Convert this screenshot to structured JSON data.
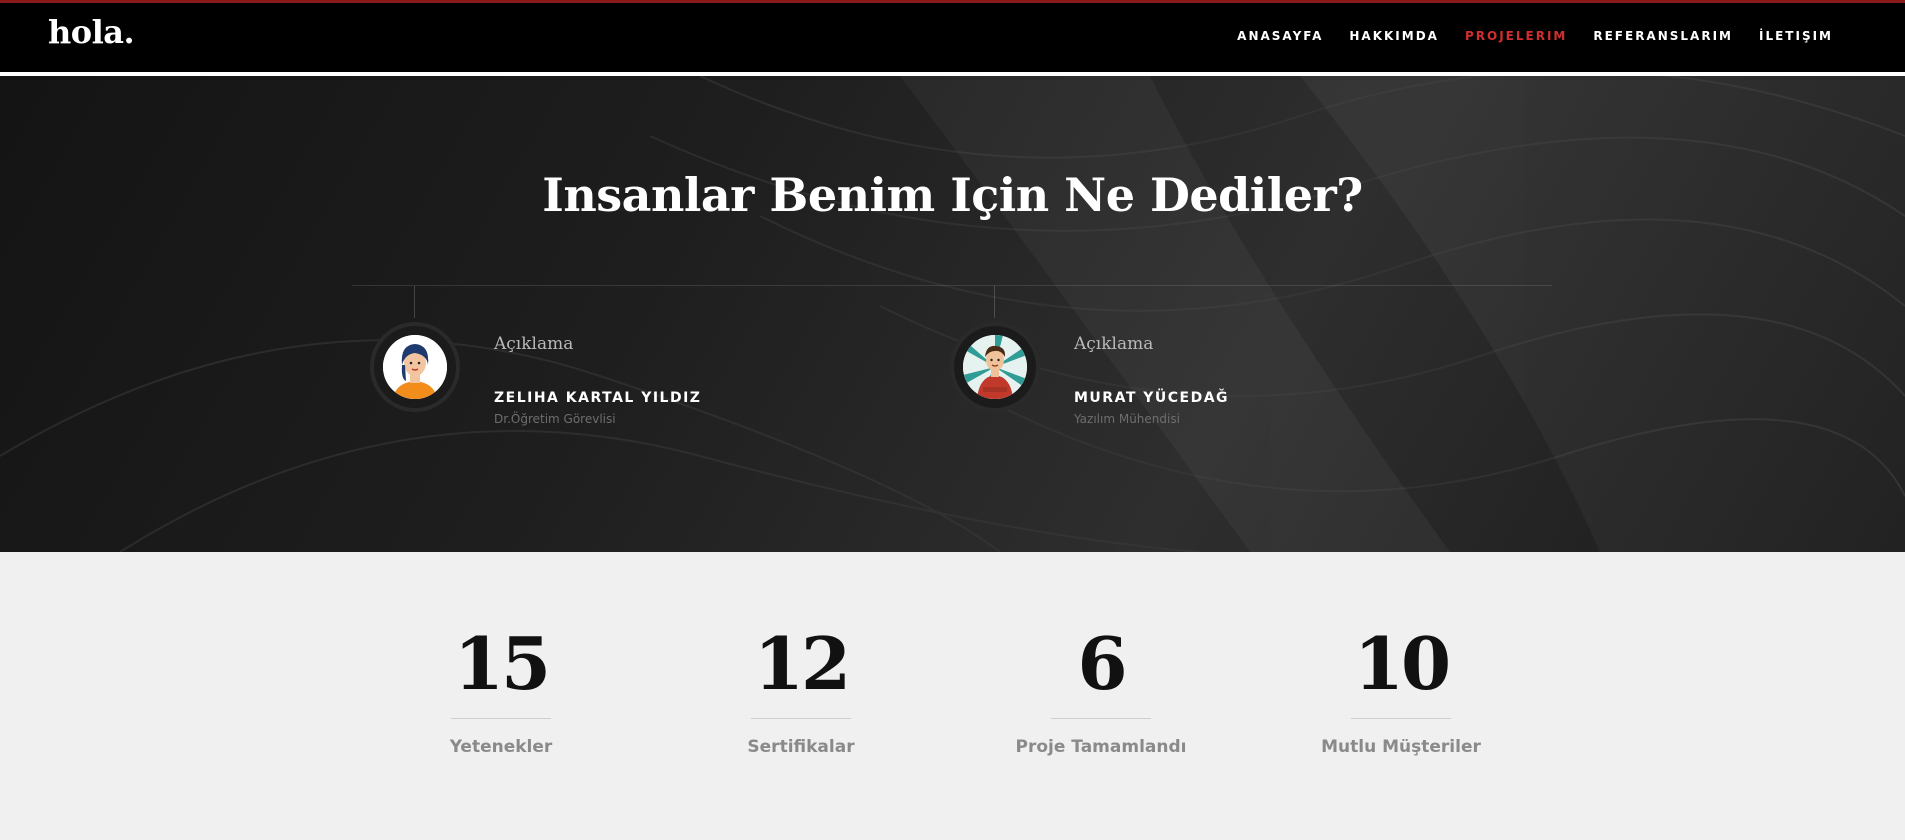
{
  "header": {
    "logo": "hola.",
    "nav": [
      {
        "label": "ANASAYFA",
        "active": false
      },
      {
        "label": "HAKKIMDA",
        "active": false
      },
      {
        "label": "PROJELERIM",
        "active": true
      },
      {
        "label": "REFERANSLARIM",
        "active": false
      },
      {
        "label": "İLETIŞIM",
        "active": false
      }
    ]
  },
  "testimonials": {
    "title": "Insanlar Benim Için Ne Dediler?",
    "items": [
      {
        "quote_label": "Açıklama",
        "name": "ZELIHA KARTAL YILDIZ",
        "role": "Dr.Öğretim Görevlisi",
        "avatar_icon": "woman-avatar-icon"
      },
      {
        "quote_label": "Açıklama",
        "name": "MURAT YÜCEDAĞ",
        "role": "Yazılım Mühendisi",
        "avatar_icon": "man-avatar-icon"
      }
    ]
  },
  "stats": [
    {
      "value": "15",
      "label": "Yetenekler"
    },
    {
      "value": "12",
      "label": "Sertifikalar"
    },
    {
      "value": "6",
      "label": "Proje Tamamlandı"
    },
    {
      "value": "10",
      "label": "Mutlu Müşteriler"
    }
  ],
  "colors": {
    "accent": "#d12f2f",
    "topbar": "#000000",
    "hero_bg": "#1e1e1e",
    "stats_bg": "#f0f0f0"
  }
}
